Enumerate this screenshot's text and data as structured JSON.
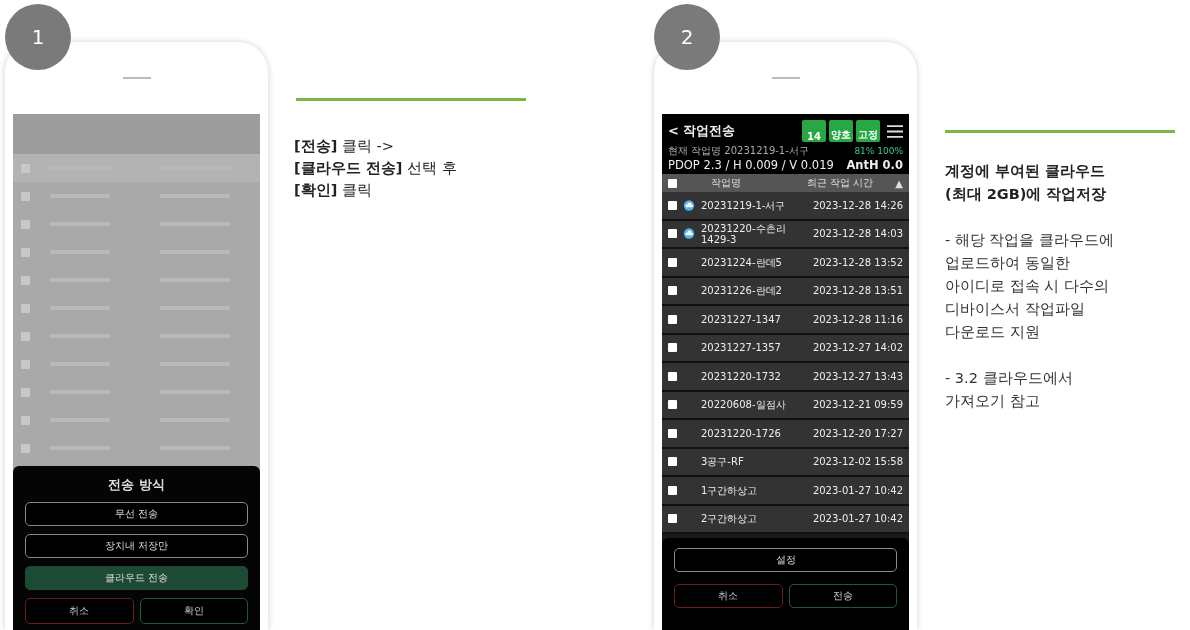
{
  "step_1": {
    "badge": "1",
    "dialog": {
      "title": "전송 방식",
      "options": [
        {
          "label": "무선 전송",
          "selected": false
        },
        {
          "label": "장치내 저장만",
          "selected": false
        },
        {
          "label": "클라우드 전송",
          "selected": true
        }
      ],
      "buttons": [
        {
          "label": "취소",
          "kind": "cancel"
        },
        {
          "label": "확인",
          "kind": "confirm"
        }
      ]
    },
    "note": [
      "**[전송]** 클릭 ->",
      "**[클라우드 전송]** 선택 후",
      "**[확인]** 클릭"
    ]
  },
  "step_2": {
    "badge": "2",
    "screen": {
      "back": "<",
      "title": "작업전송",
      "status": [
        "14",
        "양호",
        "고정"
      ],
      "job": "현재 작업명 20231219-1-서구",
      "signal": "81%",
      "battery": "100%",
      "precision": "PDOP 2.3 / H 0.009 / V 0.019",
      "antenna": "AntH 0.0",
      "select_all": {
        "checked": false
      },
      "columns": [
        "작업명",
        "최근 작업 시간",
        "▲"
      ],
      "rows": [
        {
          "name": "20231219-1-서구",
          "time": "2023-12-28 14:26",
          "cloud": true,
          "checked": false
        },
        {
          "name": "20231220-수촌리 1429-3",
          "time": "2023-12-28 14:03",
          "cloud": true,
          "checked": false
        },
        {
          "name": "20231224-란데5",
          "time": "2023-12-28 13:52",
          "cloud": false,
          "checked": false
        },
        {
          "name": "20231226-란데2",
          "time": "2023-12-28 13:51",
          "cloud": false,
          "checked": false
        },
        {
          "name": "20231227-1347",
          "time": "2023-12-28 11:16",
          "cloud": false,
          "checked": false
        },
        {
          "name": "20231227-1357",
          "time": "2023-12-27 14:02",
          "cloud": false,
          "checked": false
        },
        {
          "name": "20231220-1732",
          "time": "2023-12-27 13:43",
          "cloud": false,
          "checked": false
        },
        {
          "name": "20220608-일점사",
          "time": "2023-12-21 09:59",
          "cloud": false,
          "checked": false
        },
        {
          "name": "20231220-1726",
          "time": "2023-12-20 17:27",
          "cloud": false,
          "checked": false
        },
        {
          "name": "3공구-RF",
          "time": "2023-12-02 15:58",
          "cloud": false,
          "checked": false
        },
        {
          "name": "1구간하상고",
          "time": "2023-01-27 10:42",
          "cloud": false,
          "checked": false
        },
        {
          "name": "2구간하상고",
          "time": "2023-01-27 10:42",
          "cloud": false,
          "checked": false
        }
      ],
      "settings": "설정",
      "buttons": [
        {
          "label": "취소",
          "kind": "cancel"
        },
        {
          "label": "전송",
          "kind": "confirm"
        }
      ]
    },
    "note": {
      "heading": [
        "계정에 부여된 클라우드",
        "(최대 2GB)에 작업저장"
      ],
      "paragraphs": [
        [
          "- 해당 작업을 클라우드에",
          "업로드하여 동일한",
          "아이디로 접속 시 다수의",
          "디바이스서 작업파일",
          "다운로드 지원"
        ],
        [
          "- 3.2  클라우드에서",
          "가져오기 참고"
        ]
      ]
    }
  }
}
